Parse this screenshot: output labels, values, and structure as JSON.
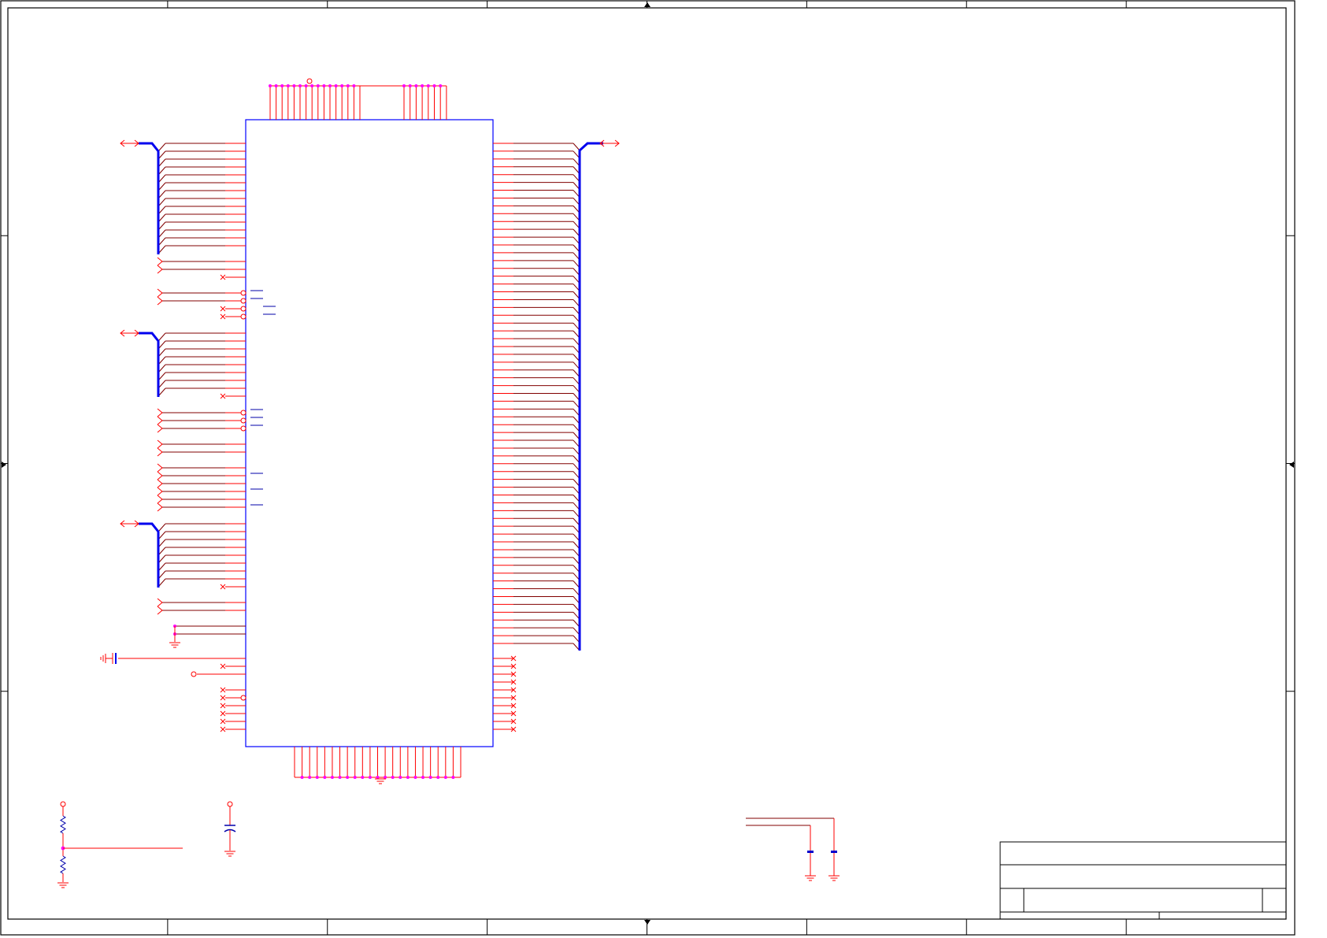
{
  "sheet": {
    "zones": {
      "columns": 8,
      "rows": 4
    },
    "colors": {
      "wire": "#ff0000",
      "net": "#800000",
      "body": "#0000ff",
      "bus": "#0000ee",
      "junction": "#ff00ff",
      "frame": "#000000"
    }
  },
  "ic": {
    "top_pins": 23,
    "bottom_pins": 23,
    "right_bus_pins": 65,
    "right_nc_pins": 10
  },
  "title_block": {
    "title": "",
    "size": "",
    "document_number": "",
    "revision": "",
    "date": "",
    "sheet": ""
  }
}
